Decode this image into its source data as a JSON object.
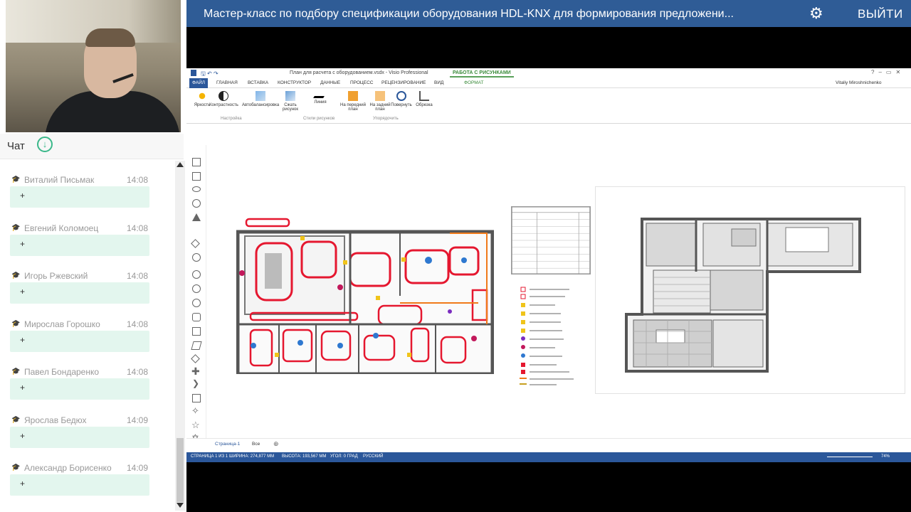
{
  "header": {
    "title": "Мастер-класс по подбору спецификации оборудования HDL-KNX для формирования предложени...",
    "exit_label": "ВЫЙТИ"
  },
  "chat": {
    "title": "Чат",
    "messages": [
      {
        "name": "Виталий Письмак",
        "time": "14:08",
        "text": "+"
      },
      {
        "name": "Евгений Коломоец",
        "time": "14:08",
        "text": "+"
      },
      {
        "name": "Игорь Ржевский",
        "time": "14:08",
        "text": "+"
      },
      {
        "name": "Мирослав Горошко",
        "time": "14:08",
        "text": "+"
      },
      {
        "name": "Павел Бондаренко",
        "time": "14:08",
        "text": "+"
      },
      {
        "name": "Ярослав Бедюх",
        "time": "14:09",
        "text": "+"
      },
      {
        "name": "Александр Борисенко",
        "time": "14:09",
        "text": "+"
      }
    ]
  },
  "visio": {
    "doc_title": "План для расчета с оборудованием.vsdx - Visio Professional",
    "context_tab": "РАБОТА С РИСУНКАМИ",
    "user": "Vitaliy Miroshnichenko",
    "tabs": [
      "ФАЙЛ",
      "ГЛАВНАЯ",
      "ВСТАВКА",
      "КОНСТРУКТОР",
      "ДАННЫЕ",
      "ПРОЦЕСС",
      "РЕЦЕНЗИРОВАНИЕ",
      "ВИД",
      "ФОРМАТ"
    ],
    "ribbon_buttons": [
      "Яркость",
      "Контрастность",
      "Автобалансировка",
      "Сжать рисунок",
      "Линия",
      "На передний план",
      "На задний план",
      "Повернуть",
      "Обрезка"
    ],
    "ribbon_groups": [
      "Настройка",
      "Стили рисунков",
      "Упорядочить"
    ],
    "page_tab": "Страница-1",
    "page_all": "Все",
    "status": {
      "page": "СТРАНИЦА 1 ИЗ 1",
      "width": "ШИРИНА: 274,877 ММ",
      "height": "ВЫСОТА: 193,567 ММ",
      "angle": "УГОЛ: 0 ГРАД",
      "lang": "РУССКИЙ",
      "zoom": "74%"
    }
  },
  "colors": {
    "topbar": "#2f5c96",
    "visio_blue": "#2b579a",
    "chat_bubble": "#e3f6ee",
    "accent_green": "#3bb88a"
  }
}
